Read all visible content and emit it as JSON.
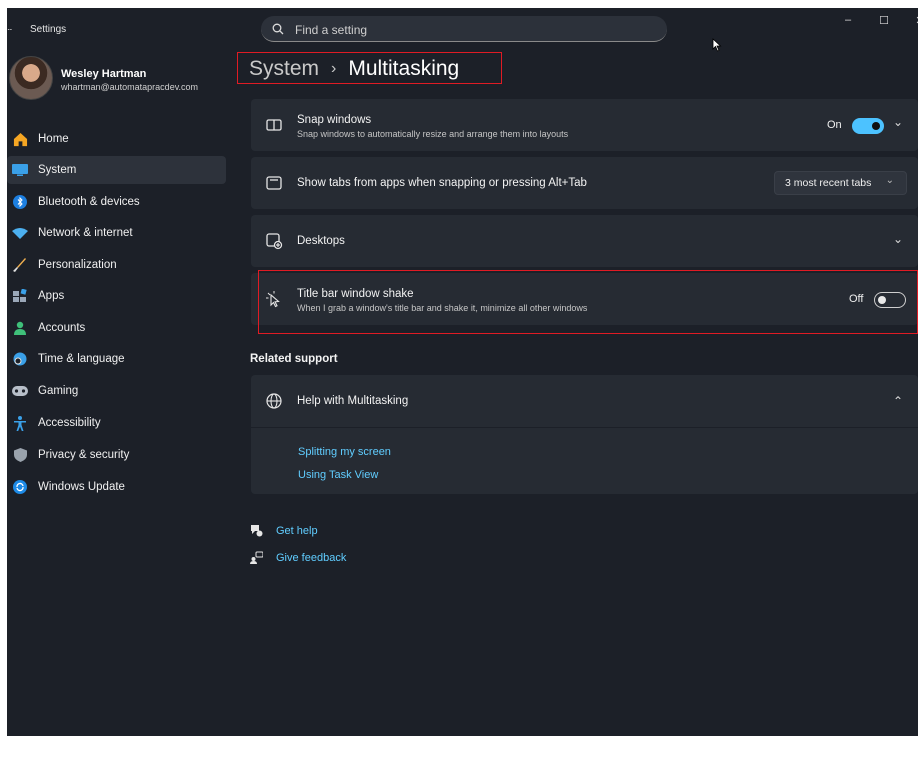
{
  "window": {
    "title": "Settings",
    "controls": {
      "minimize": "–",
      "maximize": "☐",
      "close": "✕"
    }
  },
  "search": {
    "placeholder": "Find a setting",
    "value": ""
  },
  "user": {
    "name": "Wesley Hartman",
    "email": "whartman@automatapracdev.com"
  },
  "sidebar": {
    "items": [
      {
        "label": "Home",
        "icon": "home-icon"
      },
      {
        "label": "System",
        "icon": "system-icon",
        "selected": true
      },
      {
        "label": "Bluetooth & devices",
        "icon": "bluetooth-icon"
      },
      {
        "label": "Network & internet",
        "icon": "wifi-icon"
      },
      {
        "label": "Personalization",
        "icon": "brush-icon"
      },
      {
        "label": "Apps",
        "icon": "apps-icon"
      },
      {
        "label": "Accounts",
        "icon": "accounts-icon"
      },
      {
        "label": "Time & language",
        "icon": "globe-clock-icon"
      },
      {
        "label": "Gaming",
        "icon": "controller-icon"
      },
      {
        "label": "Accessibility",
        "icon": "accessibility-icon"
      },
      {
        "label": "Privacy & security",
        "icon": "shield-icon"
      },
      {
        "label": "Windows Update",
        "icon": "update-icon"
      }
    ]
  },
  "breadcrumb": {
    "parent": "System",
    "separator": "›",
    "current": "Multitasking"
  },
  "settings": {
    "snap": {
      "title": "Snap windows",
      "subtitle": "Snap windows to automatically resize and arrange them into layouts",
      "state_label": "On",
      "enabled": true
    },
    "tabs": {
      "title": "Show tabs from apps when snapping or pressing Alt+Tab",
      "selected": "3 most recent tabs"
    },
    "desktops": {
      "title": "Desktops"
    },
    "shake": {
      "title": "Title bar window shake",
      "subtitle": "When I grab a window's title bar and shake it, minimize all other windows",
      "state_label": "Off",
      "enabled": false
    }
  },
  "related": {
    "heading": "Related support",
    "help_title": "Help with Multitasking",
    "links": [
      "Splitting my screen",
      "Using Task View"
    ]
  },
  "footer": {
    "get_help": "Get help",
    "give_feedback": "Give feedback"
  },
  "colors": {
    "accent": "#4cc2ff",
    "link": "#60cdff",
    "highlight": "#e01b24",
    "background": "#1c2028",
    "card": "#262b33"
  }
}
